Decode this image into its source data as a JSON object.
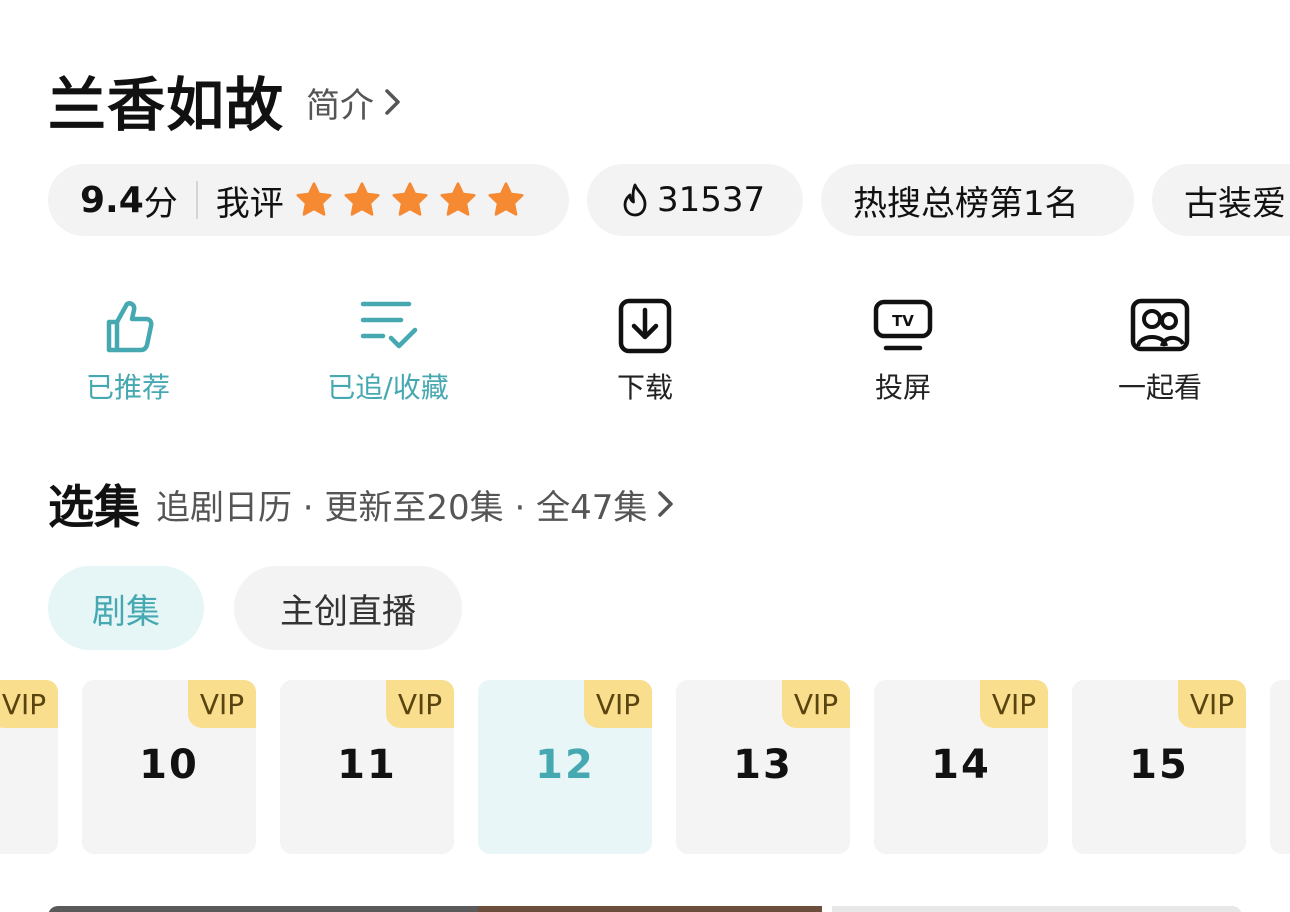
{
  "show": {
    "title": "兰香如故",
    "intro_label": "简介"
  },
  "tags": {
    "score_value": "9.4",
    "score_unit": "分",
    "my_rating_label": "我评",
    "my_rating_stars": 5,
    "star_color": "#f58a33",
    "heat_value": "31537",
    "hot_search_label": "热搜总榜第1名",
    "genre_label": "古装爱"
  },
  "actions": {
    "recommend_label": "已推荐",
    "collect_label": "已追/收藏",
    "download_label": "下载",
    "cast_label": "投屏",
    "watch_together_label": "一起看",
    "active_color": "#46a9b1"
  },
  "episodes": {
    "title": "选集",
    "meta": "追剧日历 · 更新至20集 · 全47集",
    "tabs": [
      {
        "label": "剧集",
        "active": true
      },
      {
        "label": "主创直播",
        "active": false
      }
    ],
    "vip_label": "VIP",
    "items": [
      {
        "number": "",
        "active": false
      },
      {
        "number": "10",
        "active": false
      },
      {
        "number": "11",
        "active": false
      },
      {
        "number": "12",
        "active": true
      },
      {
        "number": "13",
        "active": false
      },
      {
        "number": "14",
        "active": false
      },
      {
        "number": "15",
        "active": false
      }
    ]
  }
}
